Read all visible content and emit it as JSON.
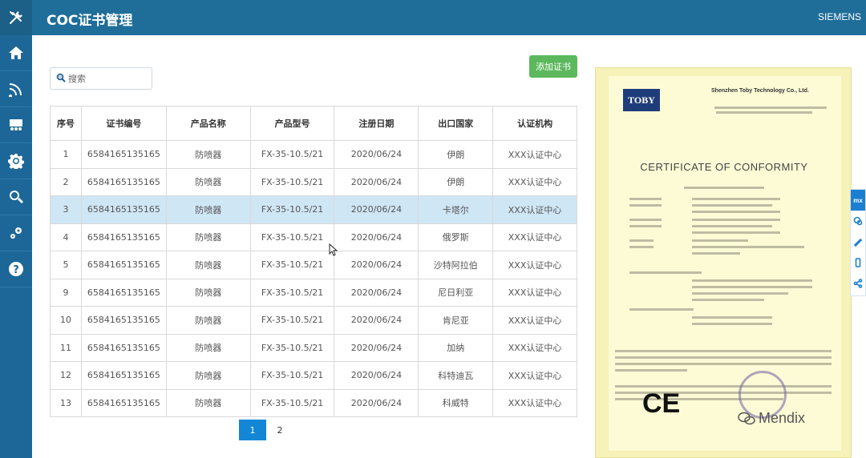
{
  "app": {
    "title": "COC证书管理",
    "brand": "SIEMENS"
  },
  "nav": [
    {
      "icon": "home-icon"
    },
    {
      "icon": "wifi-icon"
    },
    {
      "icon": "users-icon"
    },
    {
      "icon": "gear-icon"
    },
    {
      "icon": "search-icon"
    },
    {
      "icon": "settings-icon"
    },
    {
      "icon": "help-icon"
    }
  ],
  "search": {
    "placeholder": "搜索"
  },
  "toolbar": {
    "add_label": "添加证书"
  },
  "table": {
    "headers": [
      "序号",
      "证书编号",
      "产品名称",
      "产品型号",
      "注册日期",
      "出口国家",
      "认证机构"
    ],
    "rows": [
      [
        "1",
        "6584165135165",
        "防喷器",
        "FX-35-10.5/21",
        "2020/06/24",
        "伊朗",
        "XXX认证中心"
      ],
      [
        "2",
        "6584165135165",
        "防喷器",
        "FX-35-10.5/21",
        "2020/06/24",
        "伊朗",
        "XXX认证中心"
      ],
      [
        "3",
        "6584165135165",
        "防喷器",
        "FX-35-10.5/21",
        "2020/06/24",
        "卡塔尔",
        "XXX认证中心"
      ],
      [
        "4",
        "6584165135165",
        "防喷器",
        "FX-35-10.5/21",
        "2020/06/24",
        "俄罗斯",
        "XXX认证中心"
      ],
      [
        "5",
        "6584165135165",
        "防喷器",
        "FX-35-10.5/21",
        "2020/06/24",
        "沙特阿拉伯",
        "XXX认证中心"
      ],
      [
        "9",
        "6584165135165",
        "防喷器",
        "FX-35-10.5/21",
        "2020/06/24",
        "尼日利亚",
        "XXX认证中心"
      ],
      [
        "10",
        "6584165135165",
        "防喷器",
        "FX-35-10.5/21",
        "2020/06/24",
        "肯尼亚",
        "XXX认证中心"
      ],
      [
        "11",
        "6584165135165",
        "防喷器",
        "FX-35-10.5/21",
        "2020/06/24",
        "加纳",
        "XXX认证中心"
      ],
      [
        "12",
        "6584165135165",
        "防喷器",
        "FX-35-10.5/21",
        "2020/06/24",
        "科特迪瓦",
        "XXX认证中心"
      ],
      [
        "13",
        "6584165135165",
        "防喷器",
        "FX-35-10.5/21",
        "2020/06/24",
        "科威特",
        "XXX认证中心"
      ]
    ],
    "selected_row": 2
  },
  "pagination": {
    "pages": [
      "1",
      "2"
    ],
    "current": "1"
  },
  "certificate": {
    "logo": "TOBY",
    "company": "Shenzhen Toby Technology Co., Ltd.",
    "title": "CERTIFICATE OF CONFORMITY",
    "mark": "CE"
  },
  "watermark": "Mendix",
  "float_bar": {
    "badge": "mx"
  }
}
